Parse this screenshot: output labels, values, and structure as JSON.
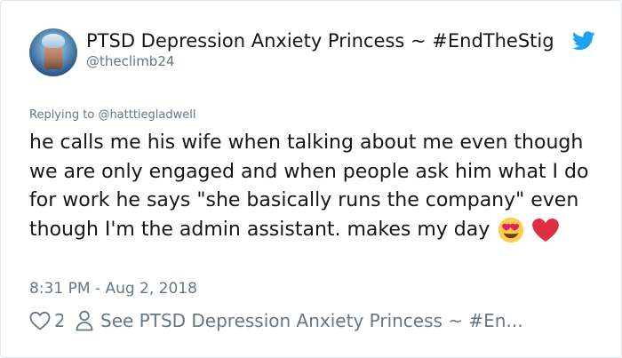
{
  "tweet": {
    "display_name": "PTSD Depression Anxiety Princess ~ #EndTheStig",
    "handle": "@theclimb24",
    "reply_prefix": "Replying to ",
    "reply_mention": "@hatttiegladwell",
    "body_text": "he calls me his wife when talking about me even though we are only engaged and when people ask him what I do for work he says \"she basically runs the company\" even though I'm the admin assistant. makes my day",
    "body_emojis": [
      "heart-eyes-emoji",
      "red-heart-emoji"
    ],
    "timestamp": "8:31 PM - Aug 2, 2018",
    "like_count": "2!",
    "see_more_label": "See PTSD Depression Anxiety Princess ~ #En..."
  },
  "icons": {
    "brand": "twitter-bird-icon",
    "like": "heart-outline-icon",
    "profile": "person-outline-icon"
  },
  "colors": {
    "text_primary": "#14171a",
    "text_secondary": "#657786",
    "twitter_blue": "#1da1f2",
    "border": "#e1e8ed",
    "heart_red": "#e0245e",
    "emoji_yellow": "#ffcc4d"
  }
}
